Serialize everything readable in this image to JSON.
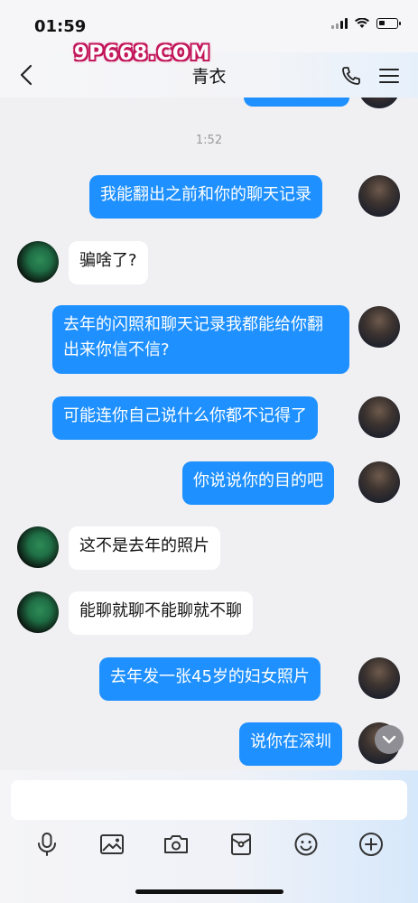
{
  "status_bar": {
    "time": "01:59"
  },
  "header": {
    "title": "青衣",
    "watermark": "9P668.COM"
  },
  "chat": {
    "timestamp": "1:52",
    "messages": [
      {
        "text": "我能翻出之前和你的聊天记录"
      },
      {
        "text": "骗啥了?"
      },
      {
        "text": "去年的闪照和聊天记录我都能给你翻出来你信不信?"
      },
      {
        "text": "可能连你自己说什么你都不记得了"
      },
      {
        "text": "你说说你的目的吧"
      },
      {
        "text": "这不是去年的照片"
      },
      {
        "text": "能聊就聊不能聊就不聊"
      },
      {
        "text": "去年发一张45岁的妇女照片"
      },
      {
        "text": "说你在深圳"
      }
    ]
  },
  "input": {
    "placeholder": ""
  },
  "toolbar": {
    "icons": [
      "microphone-icon",
      "image-icon",
      "camera-icon",
      "red-packet-icon",
      "emoji-icon",
      "plus-icon"
    ]
  },
  "colors": {
    "sent_bubble": "#1e90ff",
    "received_bubble": "#ffffff",
    "background": "#f0f0f2"
  }
}
